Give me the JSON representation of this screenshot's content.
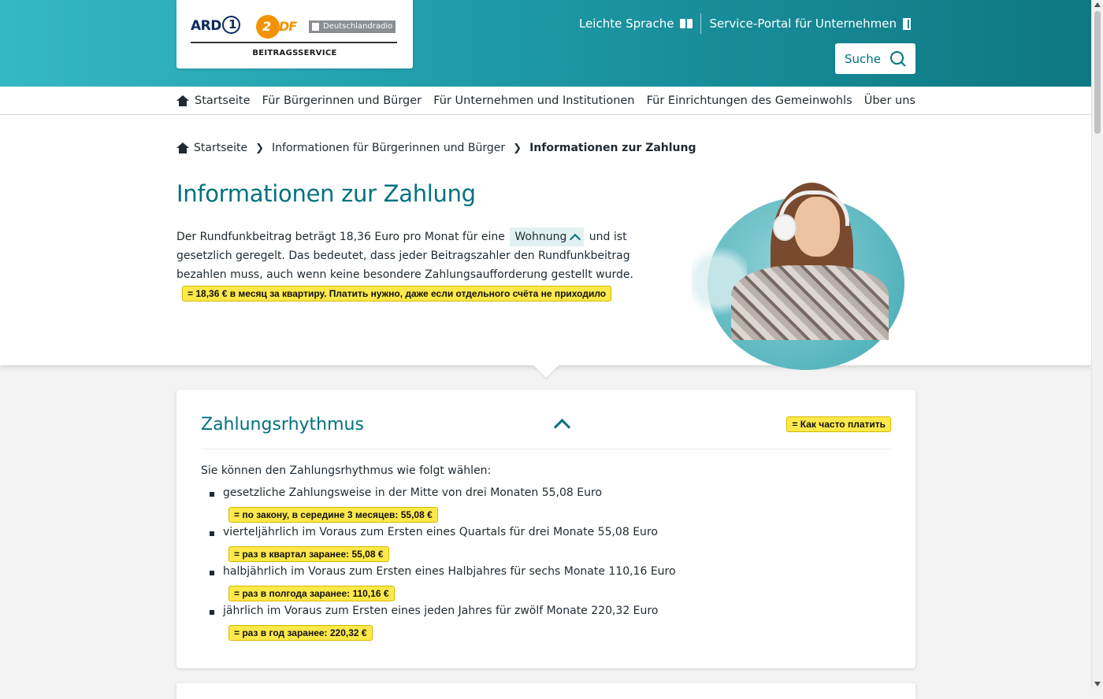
{
  "header": {
    "logo": {
      "ard": "ARD",
      "zdf": "ZDF",
      "dlr": "Deutschlandradio",
      "subtitle": "BEITRAGSSERVICE"
    },
    "links": [
      {
        "label": "Leichte Sprache",
        "icon": "book-icon"
      },
      {
        "label": "Service-Portal für Unternehmen",
        "icon": "door-icon"
      }
    ],
    "search_label": "Suche"
  },
  "nav": {
    "items": [
      {
        "label": "Startseite",
        "icon": "home-icon"
      },
      {
        "label": "Für Bürgerinnen und Bürger"
      },
      {
        "label": "Für Unternehmen und Institutionen"
      },
      {
        "label": "Für Einrichtungen des Gemeinwohls"
      },
      {
        "label": "Über uns"
      }
    ]
  },
  "breadcrumb": {
    "items": [
      "Startseite",
      "Informationen für Bürgerinnen und Bürger"
    ],
    "current": "Informationen zur Zahlung"
  },
  "intro": {
    "title": "Informationen zur Zahlung",
    "text_before": "Der Rundfunkbeitrag beträgt 18,36 Euro pro Monat für eine",
    "term": "Wohnung",
    "text_after": "und ist gesetzlich geregelt. Das bedeutet, dass jeder Beitragszahler den Rundfunkbeitrag bezahlen muss, auch wenn keine besondere Zahlungsaufforderung gestellt wurde.",
    "note": "= 18,36 € в месяц за квартиру. Платить нужно, даже если отдельного счёта не приходило"
  },
  "card": {
    "title": "Zahlungsrhythmus",
    "note": "= Как часто платить",
    "lead": "Sie können den Zahlungsrhythmus wie folgt wählen:",
    "items": [
      {
        "text": "gesetzliche Zahlungsweise in der Mitte von drei Monaten 55,08 Euro",
        "note": "= по закону, в середине 3 месяцев: 55,08 €"
      },
      {
        "text": "vierteljährlich im Voraus zum Ersten eines Quartals für drei Monate 55,08 Euro",
        "note": "= раз в квартал заранее: 55,08 €"
      },
      {
        "text": "halbjährlich im Voraus zum Ersten eines Halbjahres für sechs Monate 110,16 Euro",
        "note": "= раз в полгода заранее: 110,16 €"
      },
      {
        "text": "jährlich im Voraus zum Ersten eines jeden Jahres für zwölf Monate 220,32 Euro",
        "note": "= раз в год заранее: 220,32 €"
      }
    ]
  },
  "colors": {
    "accent": "#00727f",
    "highlight": "#ffe94a"
  }
}
